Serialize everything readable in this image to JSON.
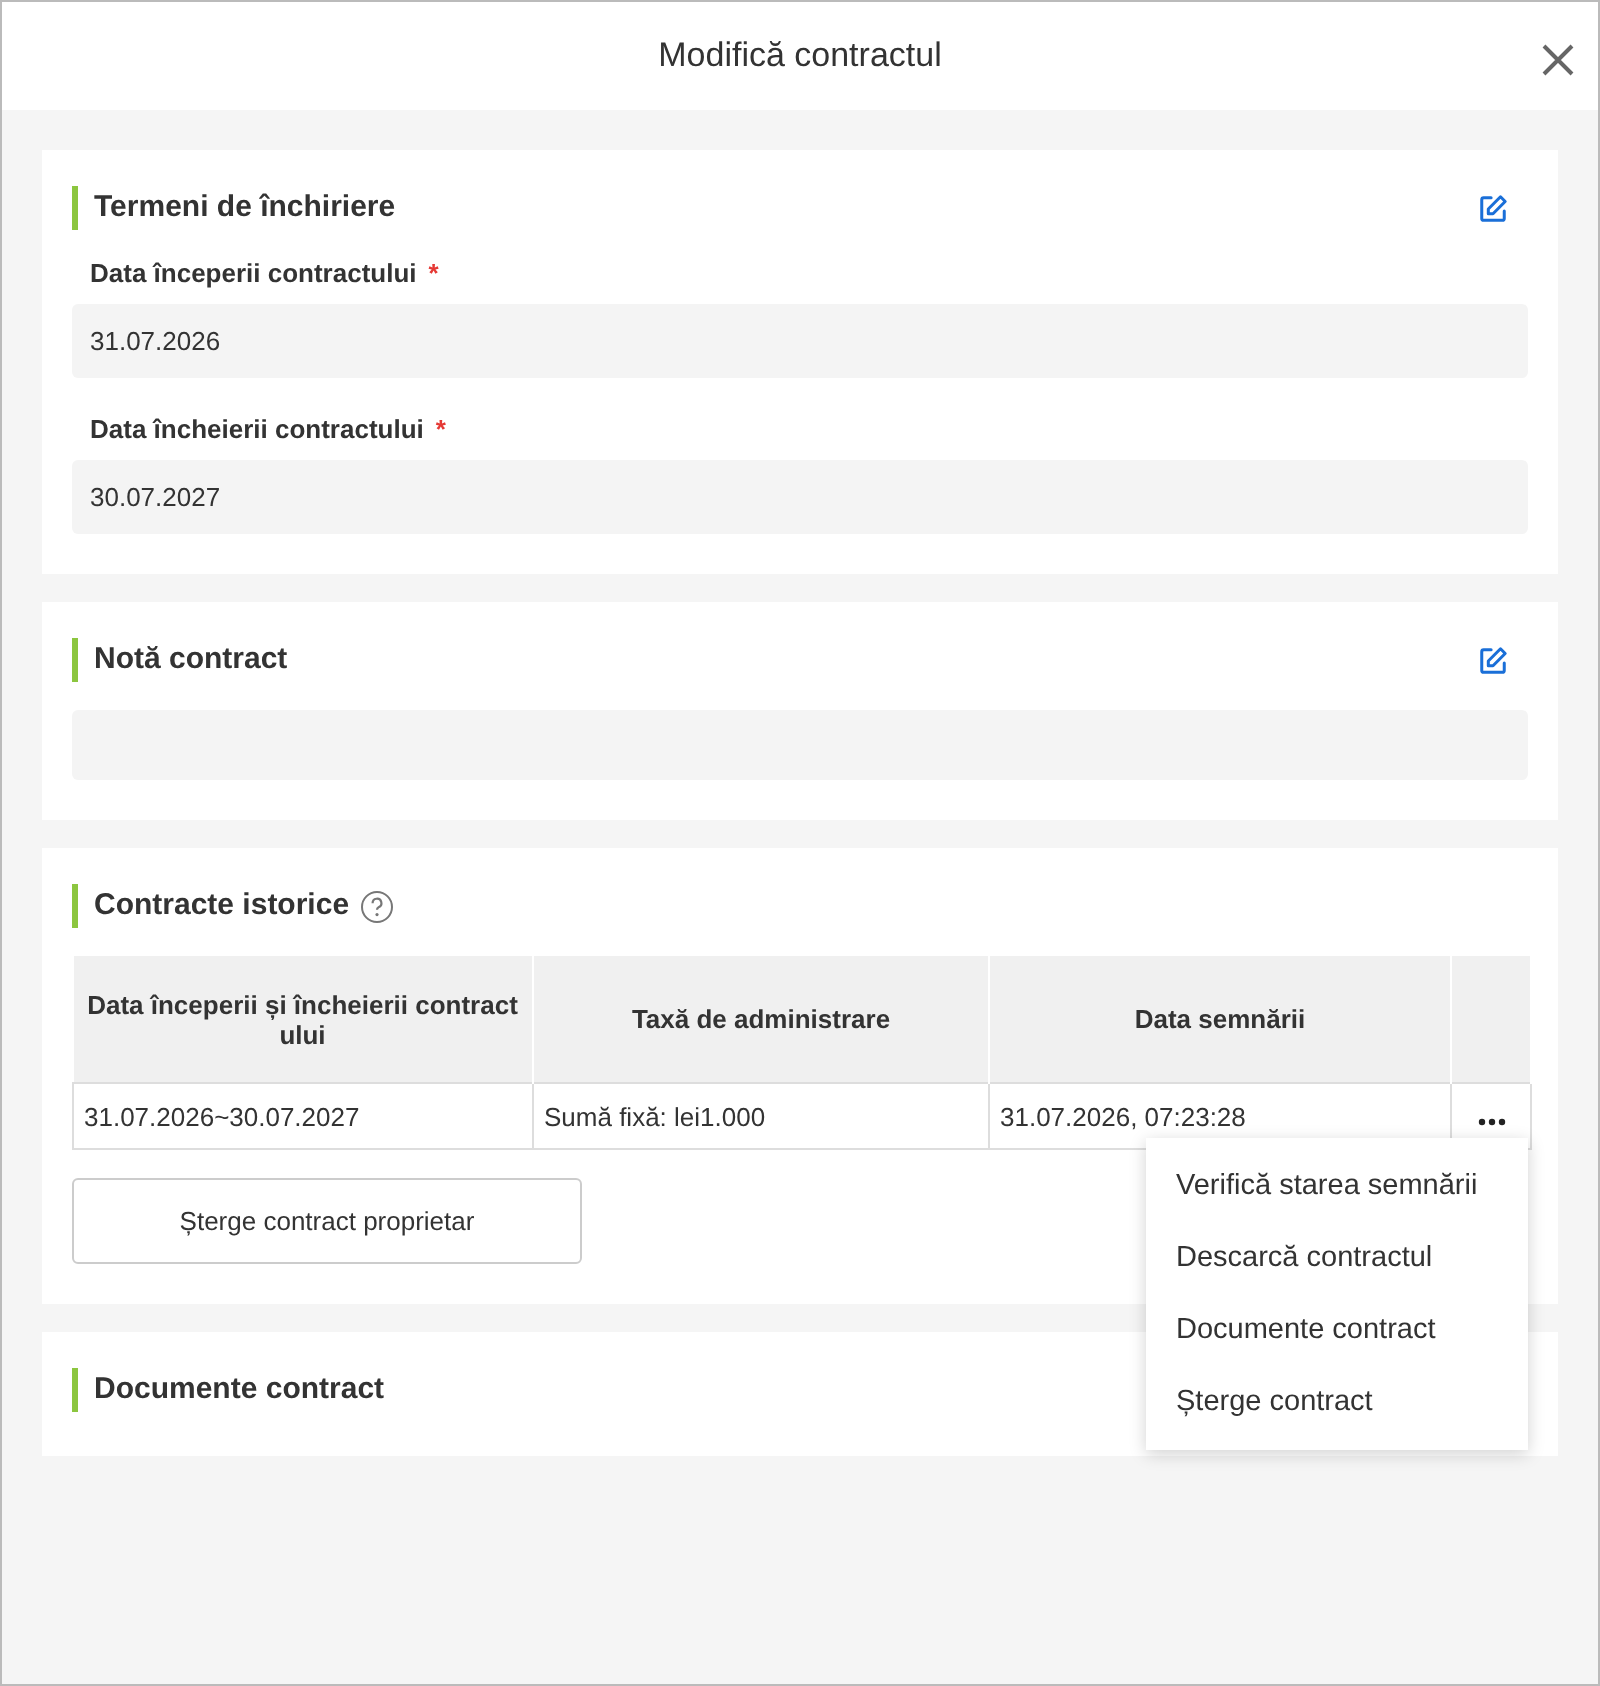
{
  "dialog": {
    "title": "Modifică contractul"
  },
  "lease_terms": {
    "title": "Termeni de închiriere",
    "fields": [
      {
        "label": "Data începerii contractului",
        "required_mark": "*",
        "value": "31.07.2026"
      },
      {
        "label": "Data încheierii contractului",
        "required_mark": "*",
        "value": "30.07.2027"
      }
    ]
  },
  "contract_note": {
    "title": "Notă contract"
  },
  "historical_contracts": {
    "title": "Contracte istorice",
    "table": {
      "columns": [
        "Data începerii și încheierii contractului",
        "Taxă de administrare",
        "Data semnării"
      ],
      "rows": [
        [
          "31.07.2026~30.07.2027",
          "Sumă fixă: lei1.000",
          "31.07.2026, 07:23:28"
        ]
      ]
    },
    "menu": {
      "items": [
        "Verifică starea semnării",
        "Descarcă contractul",
        "Documente contract",
        "Șterge contract"
      ]
    },
    "delete_button": "Șterge contract proprietar"
  },
  "contract_documents": {
    "title": "Documente contract"
  }
}
